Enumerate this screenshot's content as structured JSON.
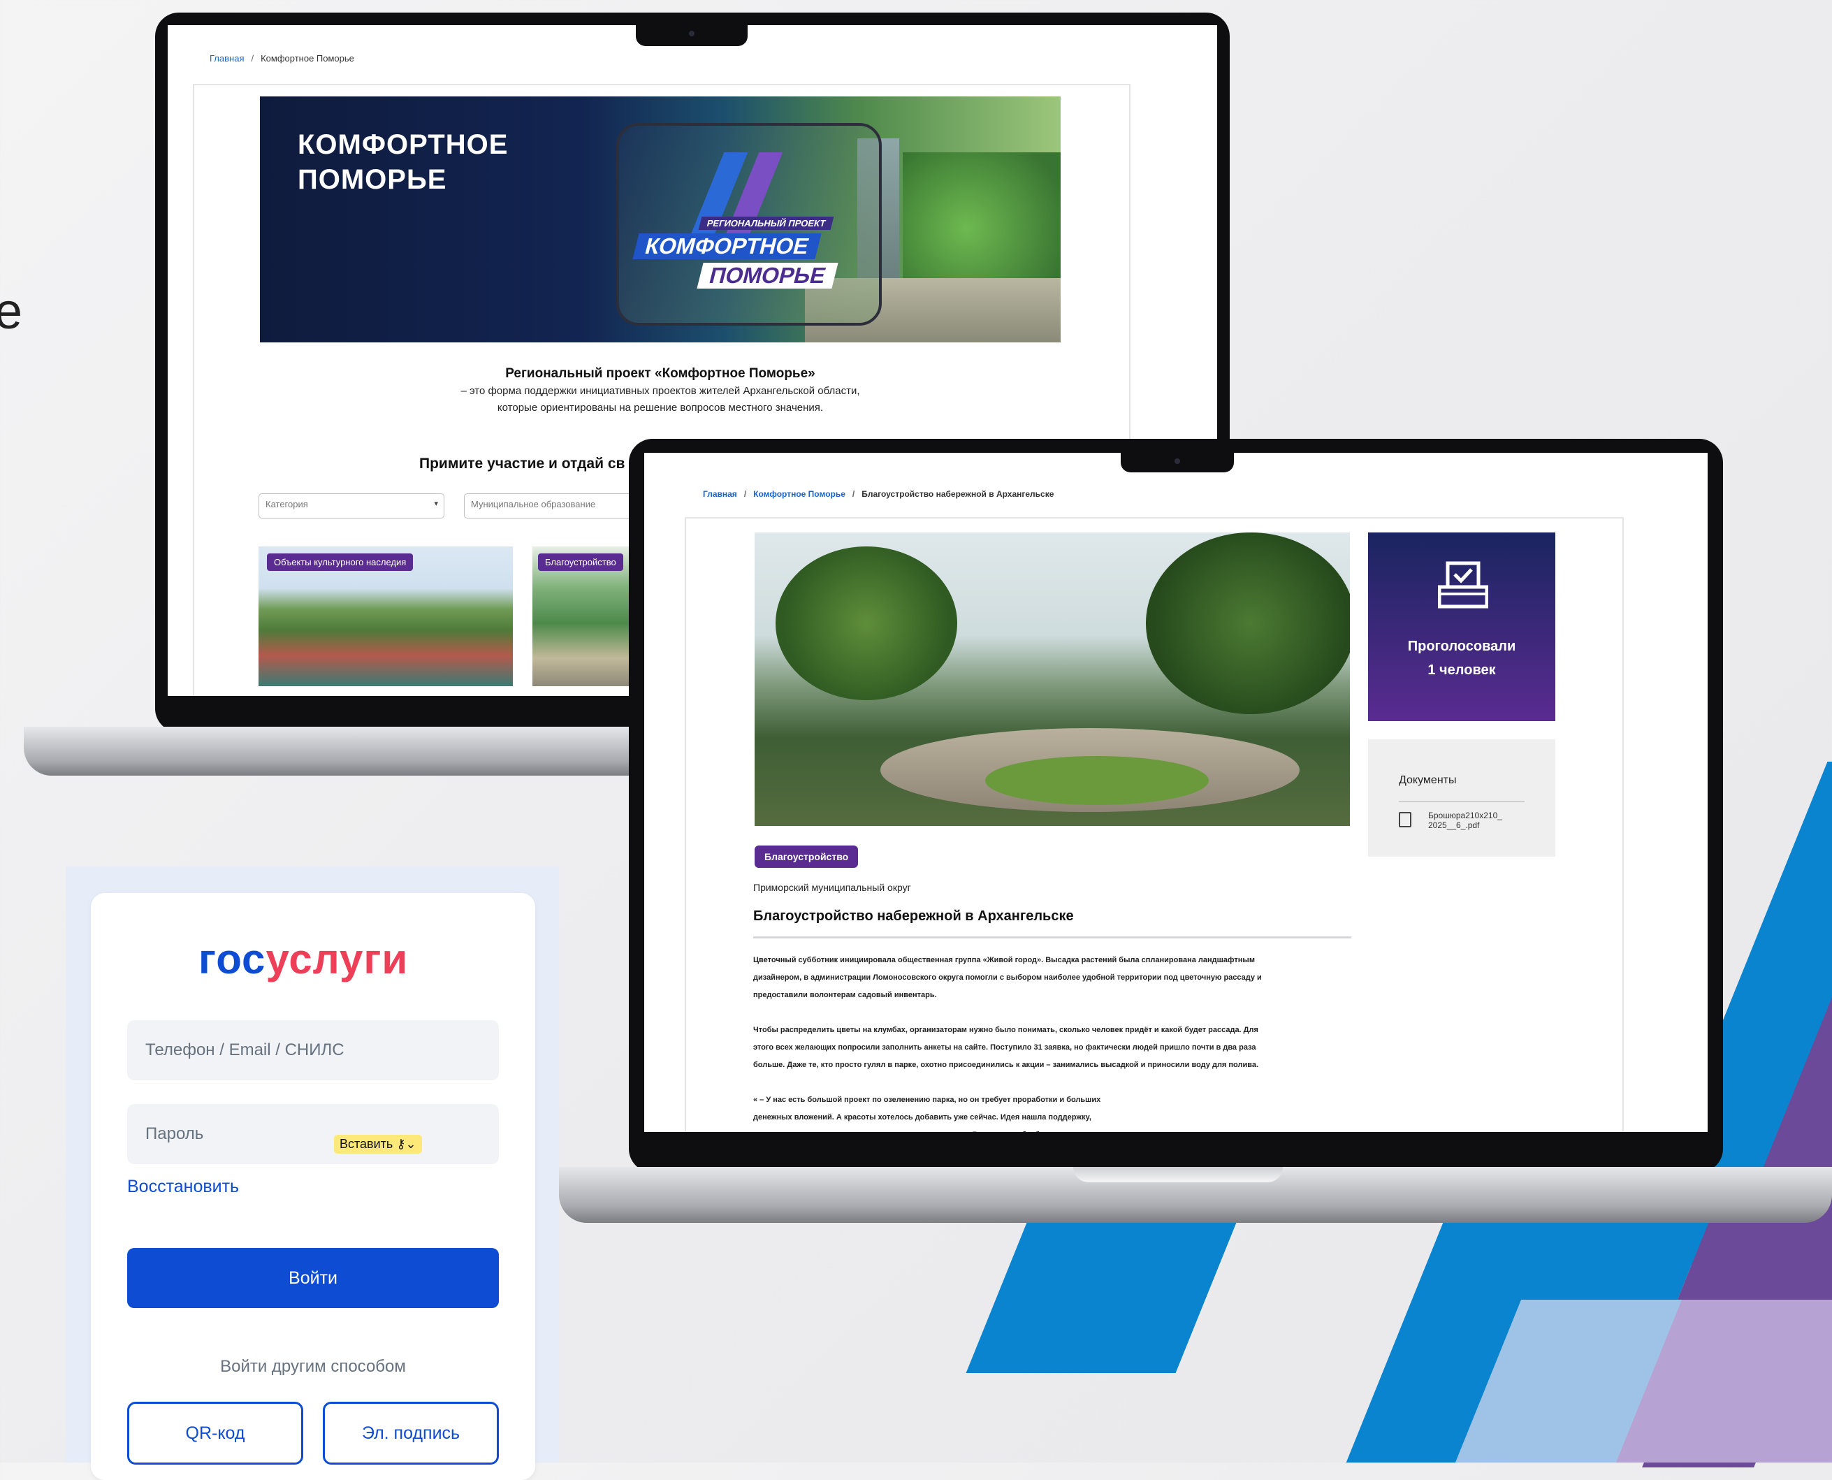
{
  "decor": {
    "edge_char": "е",
    "colors": {
      "blue": "#0a84cf",
      "purple": "#6c4a9a",
      "light_blue": "#9fc3e6",
      "light_purple": "#b7a3d3"
    }
  },
  "laptop1": {
    "breadcrumb": {
      "home": "Главная",
      "separator": "/",
      "current": "Комфортное Поморье"
    },
    "banner": {
      "title_line1": "КОМФОРТНОЕ",
      "title_line2": "ПОМОРЬЕ",
      "logo_tag": "РЕГИОНАЛЬНЫЙ ПРОЕКТ",
      "logo_word1": "КОМФОРТНОЕ",
      "logo_word2": "ПОМОРЬЕ"
    },
    "intro": {
      "heading": "Региональный проект «Комфортное Поморье»",
      "line1": "– это форма поддержки инициативных проектов жителей Архангельской области,",
      "line2": "которые ориентированы на решение вопросов местного значения."
    },
    "cta": "Примите участие и отдай св",
    "filters": {
      "category_placeholder": "Категория",
      "municipality_placeholder": "Муниципальное образование"
    },
    "cards": [
      {
        "badge": "Объекты культурного наследия"
      },
      {
        "badge": "Благоустройство"
      }
    ]
  },
  "laptop2": {
    "breadcrumb": {
      "home": "Главная",
      "separator": "/",
      "section": "Комфортное Поморье",
      "current": "Благоустройство набережной в Архангельске"
    },
    "vote": {
      "line1": "Проголосовали",
      "line2": "1 человек"
    },
    "documents": {
      "title": "Документы",
      "file_line1": "Брошюра210х210_",
      "file_line2": "2025__6_.pdf"
    },
    "tag": "Благоустройство",
    "municipality": "Приморский муниципальный округ",
    "title": "Благоустройство набережной в Архангельске",
    "body": [
      "Цветочный субботник инициировала общественная группа «Живой город». Высадка растений была спланирована ландшафтным",
      "дизайнером, в администрации Ломоносовского округа помогли с выбором наиболее удобной территории под цветочную рассаду и",
      "предоставили волонтерам садовый инвентарь.",
      "",
      "Чтобы распределить цветы на клумбах, организаторам нужно было понимать, сколько человек придёт и какой будет рассада. Для",
      "этого всех желающих попросили заполнить анкеты на сайте. Поступило 31 заявка, но фактически людей пришло почти в два раза",
      "больше. Даже те, кто просто гулял в парке, охотно присоединились к акции – занимались высадкой и приносили воду для полива.",
      "",
      "« – У нас есть большой проект по озеленению парка, но он требует проработки и больших",
      "денежных вложений. А красоты хотелось добавить уже сейчас. Идея нашла поддержку,",
      "люди приносили рассаду в дар или купили в магазинах. В итоге клумбы будут заполнены"
    ]
  },
  "login": {
    "logo_part1": "гос",
    "logo_part2": "услуги",
    "login_placeholder": "Телефон / Email / СНИЛС",
    "password_placeholder": "Пароль",
    "paste_label": "Вставить",
    "restore_link": "Восстановить",
    "submit": "Войти",
    "alt_text": "Войти другим способом",
    "qr_button": "QR-код",
    "signature_button": "Эл. подпись"
  }
}
